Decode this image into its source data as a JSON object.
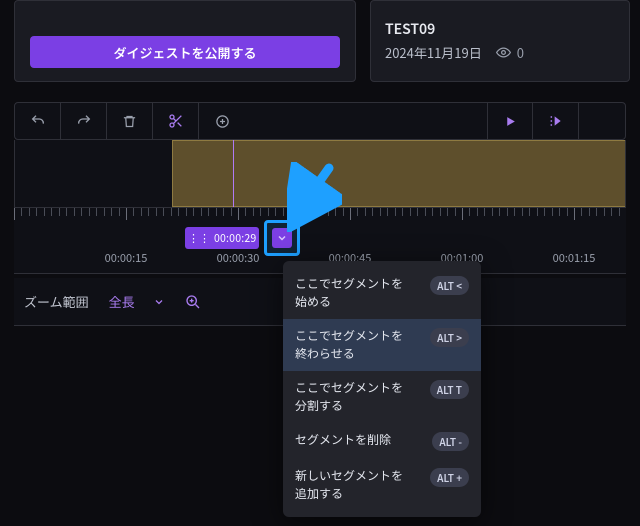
{
  "publish_button": "ダイジェストを公開する",
  "info": {
    "title": "TEST09",
    "date": "2024年11月19日",
    "views": "0"
  },
  "playhead_time": "00:00:29",
  "ruler_labels": [
    "00:00:15",
    "00:00:30",
    "00:00:45",
    "00:01:00",
    "00:01:15"
  ],
  "zoom": {
    "label": "ズーム範囲",
    "value": "全長"
  },
  "menu": {
    "items": [
      {
        "label": "ここでセグメントを始める",
        "kbd": "ALT <"
      },
      {
        "label": "ここでセグメントを終わらせる",
        "kbd": "ALT >"
      },
      {
        "label": "ここでセグメントを分割する",
        "kbd": "ALT T"
      },
      {
        "label": "セグメントを削除",
        "kbd": "ALT -"
      },
      {
        "label": "新しいセグメントを追加する",
        "kbd": "ALT +"
      }
    ]
  }
}
